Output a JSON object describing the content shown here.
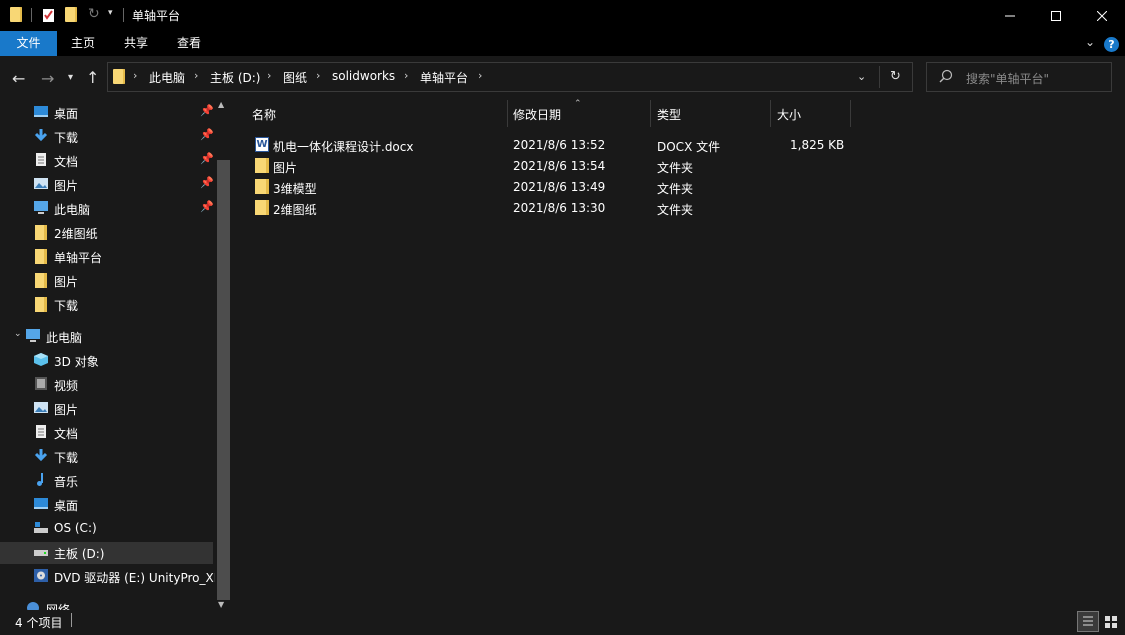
{
  "window": {
    "title": "单轴平台"
  },
  "ribbon": {
    "tabs": [
      "文件",
      "主页",
      "共享",
      "查看"
    ],
    "help": "?"
  },
  "address": {
    "crumbs": [
      "此电脑",
      "主板 (D:)",
      "图纸",
      "solidworks",
      "单轴平台"
    ]
  },
  "search": {
    "placeholder": "搜索\"单轴平台\""
  },
  "sidebar": {
    "quick_access": [
      {
        "label": "桌面",
        "icon": "desktop-icon",
        "pinned": true
      },
      {
        "label": "下载",
        "icon": "download-icon",
        "pinned": true
      },
      {
        "label": "文档",
        "icon": "document-icon",
        "pinned": true
      },
      {
        "label": "图片",
        "icon": "pictures-icon",
        "pinned": true
      },
      {
        "label": "此电脑",
        "icon": "computer-icon",
        "pinned": true
      },
      {
        "label": "2维图纸",
        "icon": "folder-icon",
        "pinned": false
      },
      {
        "label": "单轴平台",
        "icon": "folder-icon",
        "pinned": false
      },
      {
        "label": "图片",
        "icon": "folder-icon",
        "pinned": false
      },
      {
        "label": "下载",
        "icon": "folder-icon",
        "pinned": false
      }
    ],
    "this_pc": "此电脑",
    "this_pc_items": [
      {
        "label": "3D 对象",
        "icon": "3d-objects-icon"
      },
      {
        "label": "视频",
        "icon": "video-icon"
      },
      {
        "label": "图片",
        "icon": "pictures-icon"
      },
      {
        "label": "文档",
        "icon": "document-icon"
      },
      {
        "label": "下载",
        "icon": "download-icon"
      },
      {
        "label": "音乐",
        "icon": "music-icon"
      },
      {
        "label": "桌面",
        "icon": "desktop-icon"
      },
      {
        "label": "OS (C:)",
        "icon": "drive-os-icon"
      },
      {
        "label": "主板 (D:)",
        "icon": "drive-icon"
      },
      {
        "label": "DVD 驱动器 (E:) UnityPro_XL",
        "icon": "dvd-icon"
      }
    ],
    "network": "网络"
  },
  "columns": [
    "名称",
    "修改日期",
    "类型",
    "大小"
  ],
  "files": [
    {
      "name": "机电一体化课程设计.docx",
      "date": "2021/8/6 13:52",
      "type": "DOCX 文件",
      "size": "1,825 KB",
      "icon": "word-icon"
    },
    {
      "name": "图片",
      "date": "2021/8/6 13:54",
      "type": "文件夹",
      "size": "",
      "icon": "folder-icon"
    },
    {
      "name": "3维模型",
      "date": "2021/8/6 13:49",
      "type": "文件夹",
      "size": "",
      "icon": "folder-icon"
    },
    {
      "name": "2维图纸",
      "date": "2021/8/6 13:30",
      "type": "文件夹",
      "size": "",
      "icon": "folder-icon"
    }
  ],
  "status": {
    "count": "4 个项目"
  },
  "colors": {
    "accent": "#1979ca",
    "folder": "#f8d775",
    "background": "#191919"
  }
}
